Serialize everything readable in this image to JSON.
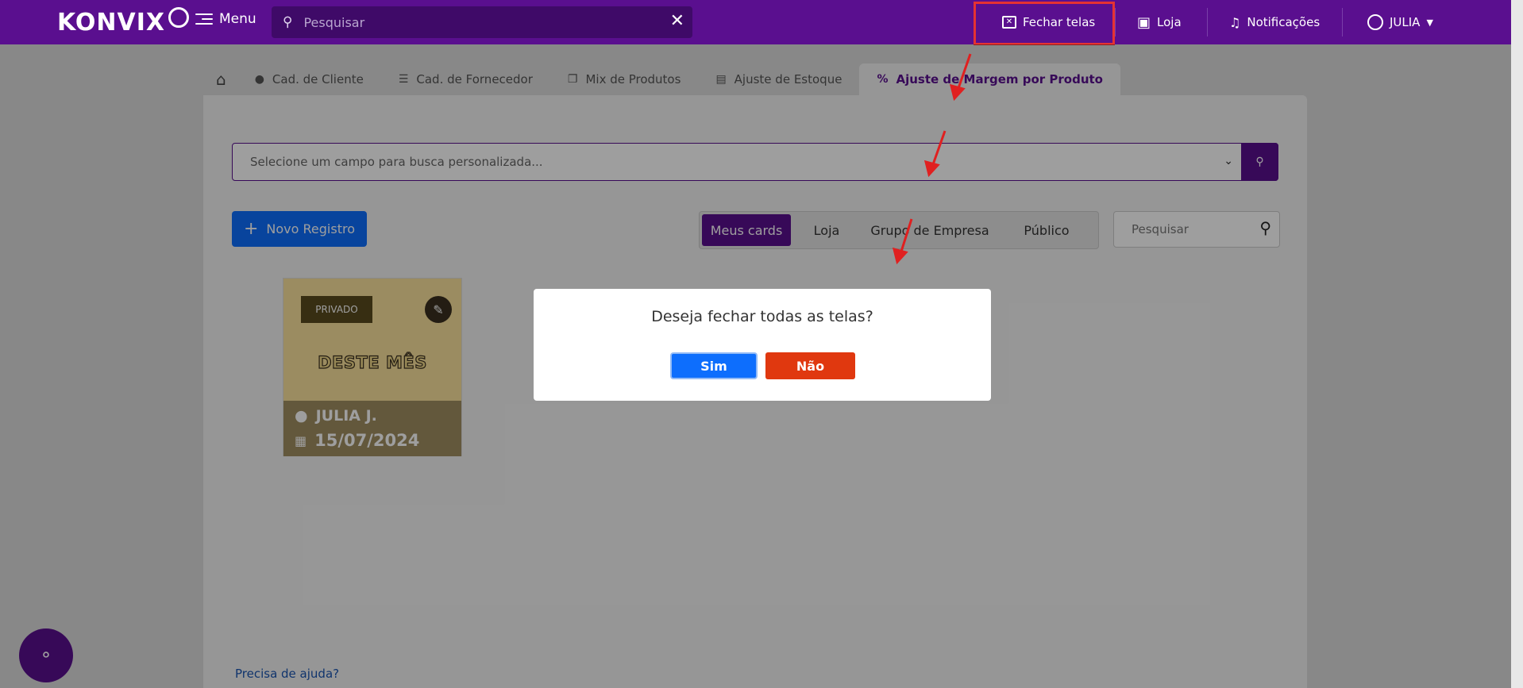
{
  "topbar": {
    "logo": "KONVIX",
    "menu_label": "Menu",
    "search_placeholder": "Pesquisar",
    "close_screens_label": "Fechar telas",
    "store_label": "Loja",
    "notifications_label": "Notificações",
    "user_label": "JULIA"
  },
  "tabs": [
    {
      "label": "Cad. de Cliente"
    },
    {
      "label": "Cad. de Fornecedor"
    },
    {
      "label": "Mix de Produtos"
    },
    {
      "label": "Ajuste de Estoque"
    },
    {
      "label": "Ajuste de Margem por Produto"
    }
  ],
  "main": {
    "field_search_placeholder": "Selecione um campo para busca personalizada...",
    "new_record_label": "Novo Registro",
    "segments": [
      "Meus cards",
      "Loja",
      "Grupo de Empresa",
      "Público"
    ],
    "search_placeholder": "Pesquisar",
    "help_link": "Precisa de ajuda?"
  },
  "card": {
    "badge": "PRIVADO",
    "title": "DESTE MÊS",
    "user": "JULIA J.",
    "date": "15/07/2024"
  },
  "modal": {
    "question": "Deseja fechar todas as telas?",
    "yes": "Sim",
    "no": "Não"
  },
  "colors": {
    "brand": "#5a0f8f",
    "primary": "#0d6efd",
    "danger": "#e0380f",
    "highlight": "#e53232"
  }
}
